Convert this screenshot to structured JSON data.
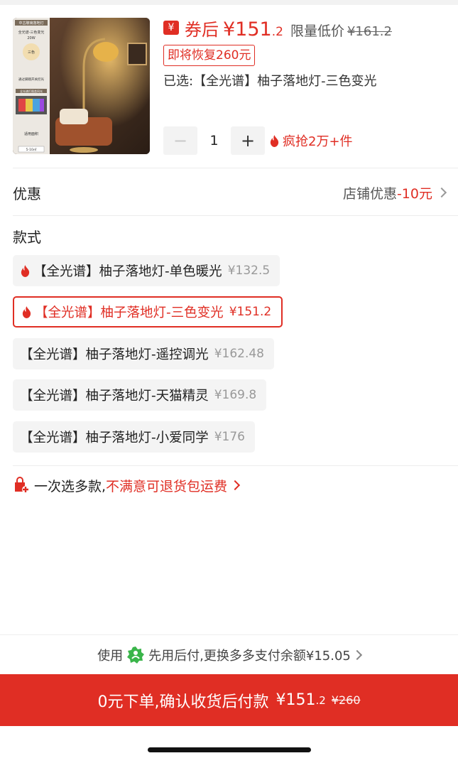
{
  "product": {
    "coupon_icon": "¥",
    "price_prefix": "券后",
    "price_main": "¥151",
    "price_decimal": ".2",
    "limited_label": "限量低价",
    "original_price": "¥161.2",
    "restore_notice": "即将恢复260元",
    "selected_text": "已选:【全光谱】柚子落地灯-三色变光",
    "thumb_icon": "floor-lamp-photo",
    "thumb": {
      "top_tag": "中古玻璃落地灯",
      "lines": [
        "全光谱-三色变光",
        "20W"
      ],
      "circle_label": "三色",
      "bottom_line": "通过脚踏开关控光",
      "spectrum_tag": "全光谱灯图类同光",
      "area_label": "适用面积",
      "area_value": "5-10㎡"
    }
  },
  "quantity": {
    "minus_label": "−",
    "value": "1",
    "plus_label": "+",
    "hot_text": "疯抢2万+件"
  },
  "discount": {
    "label": "优惠",
    "value_prefix": "店铺优惠",
    "value_amount": "-10元"
  },
  "styles": {
    "title": "款式",
    "variants": [
      {
        "name": "【全光谱】柚子落地灯-单色暖光",
        "price": "¥132.5",
        "hot": true,
        "selected": false
      },
      {
        "name": "【全光谱】柚子落地灯-三色变光",
        "price": "¥151.2",
        "hot": true,
        "selected": true
      },
      {
        "name": "【全光谱】柚子落地灯-遥控调光",
        "price": "¥162.48",
        "hot": false,
        "selected": false
      },
      {
        "name": "【全光谱】柚子落地灯-天猫精灵",
        "price": "¥169.8",
        "hot": false,
        "selected": false
      },
      {
        "name": "【全光谱】柚子落地灯-小爱同学",
        "price": "¥176",
        "hot": false,
        "selected": false
      }
    ]
  },
  "promo": {
    "text": "一次选多款,",
    "red_text": "不满意可退货包运费"
  },
  "pay_later": {
    "prefix": "使用",
    "text": "先用后付,更换多多支付余额¥15.05"
  },
  "order_button": {
    "text": "0元下单,确认收货后付款",
    "price": "¥151",
    "price_decimal": ".2",
    "original": "¥260"
  },
  "colors": {
    "accent": "#e02e24",
    "green": "#3ab54a"
  }
}
